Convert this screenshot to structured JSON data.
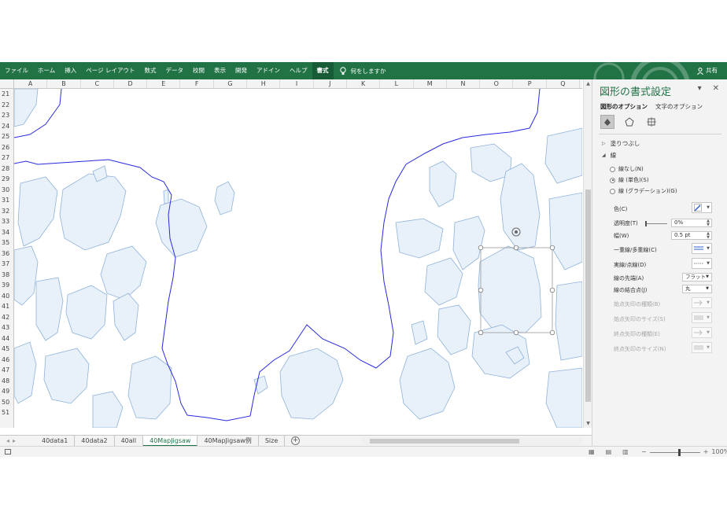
{
  "ribbon": {
    "tabs": [
      "ファイル",
      "ホーム",
      "挿入",
      "ページ レイアウト",
      "数式",
      "データ",
      "校閲",
      "表示",
      "開発",
      "アドイン",
      "ヘルプ",
      "書式"
    ],
    "active_tab": "書式",
    "tell_me": "何をしますか",
    "share": "共有"
  },
  "grid": {
    "columns": [
      "A",
      "B",
      "C",
      "D",
      "E",
      "F",
      "G",
      "H",
      "I",
      "J",
      "K",
      "L",
      "M",
      "N",
      "O",
      "P",
      "Q"
    ],
    "rows": [
      "21",
      "22",
      "23",
      "24",
      "25",
      "26",
      "27",
      "28",
      "29",
      "30",
      "31",
      "32",
      "33",
      "34",
      "35",
      "36",
      "37",
      "38",
      "39",
      "40",
      "41",
      "42",
      "43",
      "44",
      "45",
      "46",
      "47",
      "48",
      "49",
      "50",
      "51"
    ]
  },
  "sheets": {
    "tabs": [
      "40data1",
      "40data2",
      "40all",
      "40MapJigsaw",
      "40MapJigsaw例",
      "Size"
    ],
    "active": "40MapJigsaw"
  },
  "status": {
    "zoom": "100%",
    "zoom_minus": "−",
    "zoom_plus": "+"
  },
  "pane": {
    "title": "図形の書式設定",
    "tab_shape": "図形のオプション",
    "tab_text": "文字のオプション",
    "fill_section": "塗りつぶし",
    "line_section": "線",
    "radio_none": "線なし(N)",
    "radio_solid": "線 (単色)(S)",
    "radio_gradient": "線 (グラデーション)(G)",
    "color_label": "色(C)",
    "transparency_label": "透明度(T)",
    "transparency_value": "0%",
    "width_label": "幅(W)",
    "width_value": "0.5 pt",
    "compound_label": "一重線/多重線(C)",
    "dash_label": "実線/点線(D)",
    "cap_label": "線の先端(A)",
    "cap_value": "フラット",
    "join_label": "線の結合点(J)",
    "join_value": "丸",
    "begin_arrow_type": "始点矢印の種類(B)",
    "begin_arrow_size": "始点矢印のサイズ(S)",
    "end_arrow_type": "終点矢印の種類(E)",
    "end_arrow_size": "終点矢印のサイズ(N)"
  },
  "colors": {
    "ribbon": "#217346",
    "map_fill": "#e8f0fa",
    "map_stroke": "#8fb3d9",
    "region_outline": "#2a2ae0"
  }
}
